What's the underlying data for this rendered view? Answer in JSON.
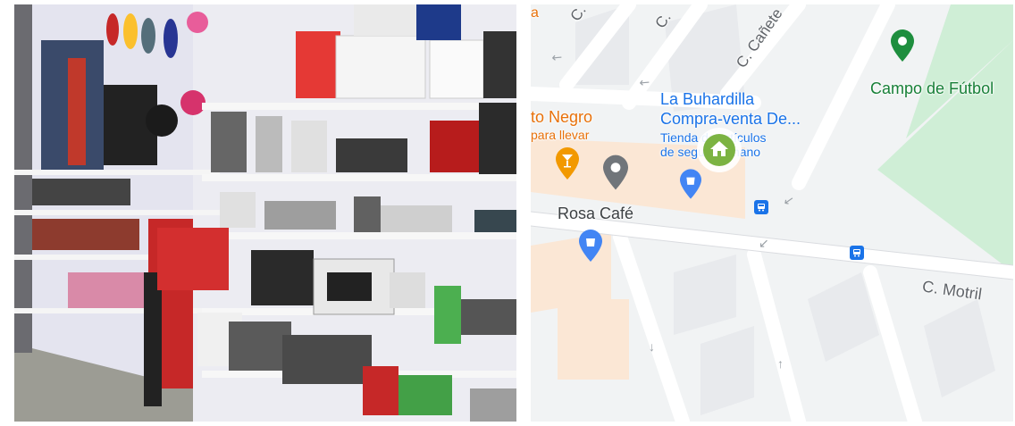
{
  "photo": {
    "icon": "appliance-store-interior-photo"
  },
  "map": {
    "streets": [
      "C.",
      "C. ",
      "C. Cañete",
      "C. Motril"
    ],
    "places": {
      "negro_partial": "to Negro",
      "para_llevar": "para llevar",
      "partial_a": "a",
      "buhardilla_name": "La Buhardilla",
      "buhardilla_line2": "Compra-venta De...",
      "buhardilla_sub1": "Tienda de artículos",
      "buhardilla_sub2": "de segunda mano",
      "rosa_cafe": "Rosa Café",
      "campo": "Campo de Fútbol"
    },
    "colors": {
      "water": "#c8e6c9",
      "park": "#cfeed6",
      "pin_green": "#1e8e3e",
      "pin_blue": "#4285f4",
      "pin_orange": "#f29900",
      "pin_grey": "#70757a",
      "home_green": "#7cb342"
    }
  }
}
